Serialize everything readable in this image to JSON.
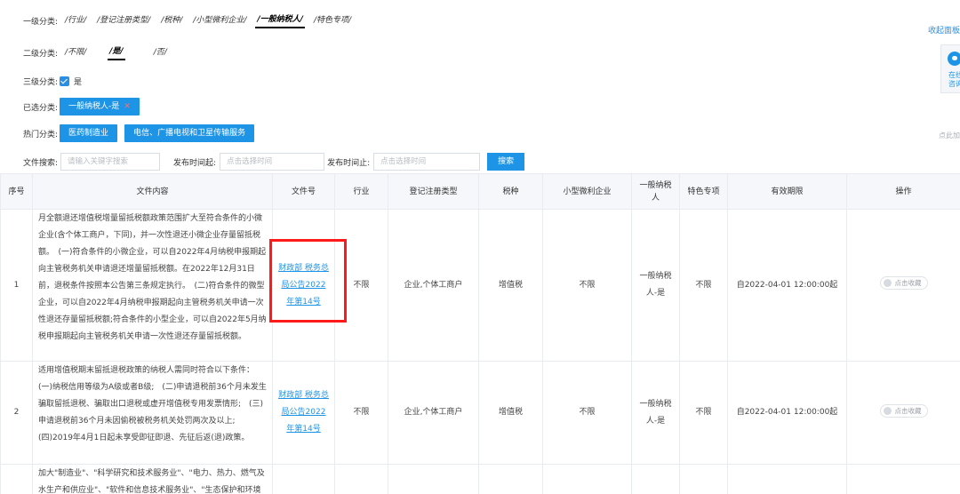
{
  "filters": {
    "level1": {
      "label": "一级分类:",
      "options": [
        "/行业/",
        "/登记注册类型/",
        "/税种/",
        "/小型微利企业/",
        "/一般纳税人/",
        "/特色专项/"
      ],
      "active_index": 4
    },
    "level2": {
      "label": "二级分类:",
      "options": [
        "/不限/",
        "/是/",
        "/否/"
      ],
      "active_index": 1
    },
    "level3": {
      "label": "三级分类:",
      "option": "是"
    },
    "selected": {
      "label": "已选分类:",
      "tag": "一般纳税人-是",
      "remove": "✕"
    },
    "hot": {
      "label": "热门分类:",
      "tags": [
        "医药制造业",
        "电信、广播电视和卫星传输服务"
      ]
    },
    "search": {
      "label": "文件搜索:",
      "placeholder": "请输入关键字搜索",
      "start_label": "发布时间起:",
      "start_placeholder": "点击选择时间",
      "end_label": "发布时间止:",
      "end_placeholder": "点击选择时间",
      "button": "搜索"
    }
  },
  "side": {
    "collapse": "收起面板",
    "chat_line1": "在线",
    "chat_line2": "咨询",
    "hint": "点此加"
  },
  "table": {
    "headers": [
      "序号",
      "文件内容",
      "文件号",
      "行业",
      "登记注册类型",
      "税种",
      "小型微利企业",
      "一般纳税人",
      "特色专项",
      "有效期限",
      "操作"
    ],
    "rows": [
      {
        "index": "1",
        "content": "月全额退还增值税增量留抵税额政策范围扩大至符合条件的小微企业(含个体工商户，下同)，并一次性退还小微企业存量留抵税额。　(一)符合条件的小微企业，可以自2022年4月纳税申报期起向主管税务机关申请退还增量留抵税额。在2022年12月31日前，退税条件按照本公告第三条规定执行。　(二)符合条件的微型企业，可以自2022年4月纳税申报期起向主管税务机关申请一次性退还存量留抵税额;符合条件的小型企业，可以自2022年5月纳税申报期起向主管税务机关申请一次性退还存量留抵税额。",
        "doc": "财政部 税务总局公告2022年第14号",
        "industry": "不限",
        "reg_type": "企业,个体工商户",
        "tax": "增值税",
        "small": "不限",
        "general": "一般纳税人-是",
        "special": "不限",
        "validity": "自2022-04-01 12:00:00起",
        "action": "点击收藏"
      },
      {
        "index": "2",
        "content": "适用增值税期末留抵退税政策的纳税人需同时符合以下条件：　(一)纳税信用等级为A级或者B级;　(二)申请退税前36个月未发生骗取留抵退税、骗取出口退税或虚开增值税专用发票情形;　(三)申请退税前36个月未因偷税被税务机关处罚两次及以上;　(四)2019年4月1日起未享受即征即退、先征后返(退)政策。",
        "doc": "财政部 税务总局公告2022年第14号",
        "industry": "不限",
        "reg_type": "企业,个体工商户",
        "tax": "增值税",
        "small": "不限",
        "general": "一般纳税人-是",
        "special": "不限",
        "validity": "自2022-04-01 12:00:00起",
        "action": "点击收藏"
      },
      {
        "index": "",
        "content": "加大\"制造业\"、\"科学研究和技术服务业\"、\"电力、热力、燃气及水生产和供应业\"、\"软件和信息技术服务业\"、\"生态保护和环境",
        "doc": "",
        "industry": "",
        "reg_type": "",
        "tax": "",
        "small": "",
        "general": "",
        "special": "",
        "validity": "",
        "action": ""
      }
    ]
  },
  "colors": {
    "accent": "#1e94e6",
    "highlight": "#ff1a1a",
    "remove_x": "#ff6d6d"
  }
}
